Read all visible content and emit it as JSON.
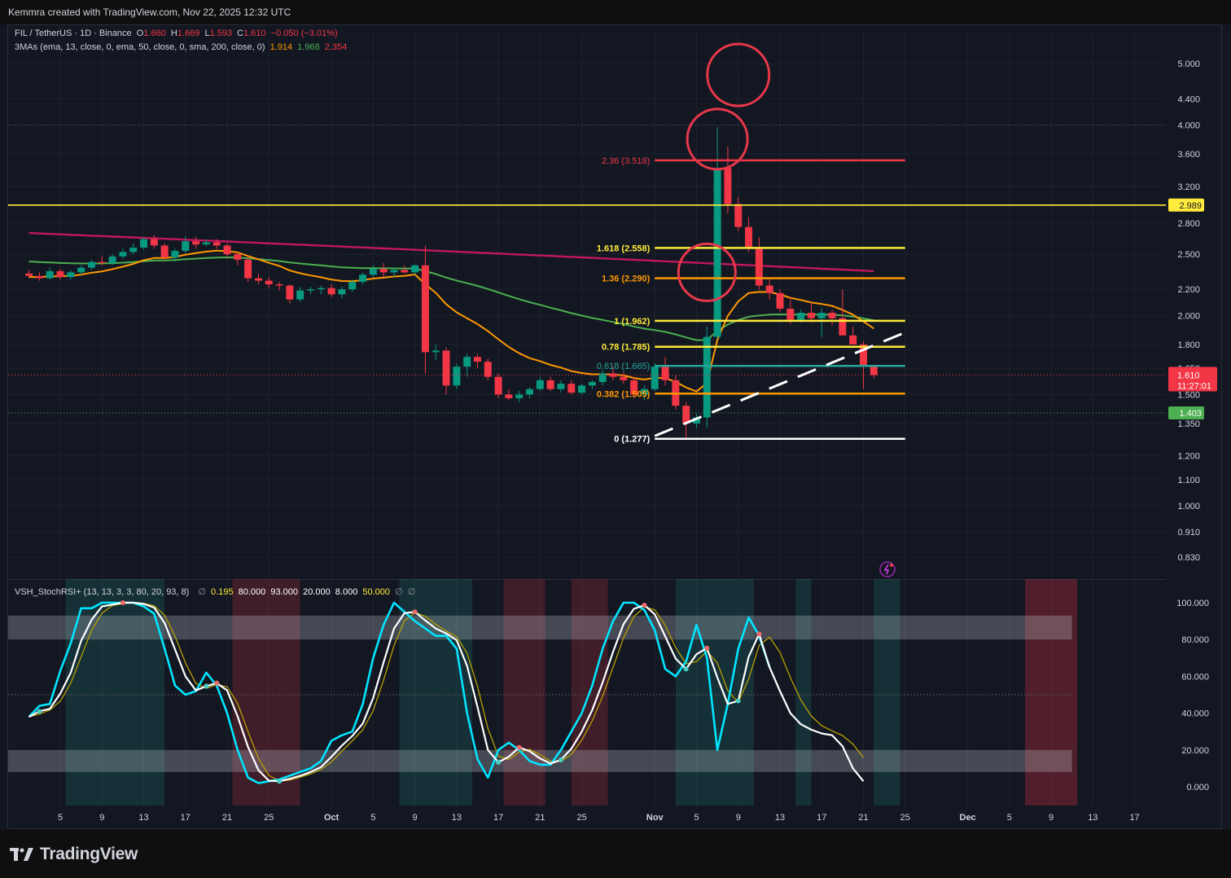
{
  "header": {
    "credit": "Kemmra created with TradingView.com, Nov 22, 2025 12:32 UTC"
  },
  "legend": {
    "symbol": "FIL / TetherUS · 1D · Binance",
    "o_label": "O",
    "o_value": "1.660",
    "h_label": "H",
    "h_value": "1.669",
    "l_label": "L",
    "l_value": "1.593",
    "c_label": "C",
    "c_value": "1.610",
    "change": "−0.050 (−3.01%)",
    "ma_title": "3MAs (ema, 13, close, 0, ema, 50, close, 0, sma, 200, close, 0)",
    "ma1": "1.914",
    "ma2": "1.968",
    "ma3": "2.354"
  },
  "indicator_legend": {
    "title": "VSH_StochRSI+ (13, 13, 3, 3, 80, 20, 93, 8)",
    "v0": "∅",
    "v1": "0.195",
    "v2": "80.000",
    "v3": "93.000",
    "v4": "20.000",
    "v5": "8.000",
    "v6": "50.000",
    "v7": "∅",
    "v8": "∅"
  },
  "price_axis": {
    "labels": [
      "5.000",
      "4.400",
      "4.000",
      "3.600",
      "3.200",
      "2.800",
      "2.500",
      "2.200",
      "2.000",
      "1.800",
      "1.650",
      "1.500",
      "1.350",
      "1.200",
      "1.100",
      "1.000",
      "0.910",
      "0.830"
    ]
  },
  "indicator_axis": {
    "labels": [
      "100.000",
      "80.000",
      "60.000",
      "40.000",
      "20.000",
      "0.000"
    ]
  },
  "time_axis": {
    "labels": [
      "5",
      "9",
      "13",
      "17",
      "21",
      "25",
      "Oct",
      "5",
      "9",
      "13",
      "17",
      "21",
      "25",
      "Nov",
      "5",
      "9",
      "13",
      "17",
      "21",
      "25",
      "Dec",
      "5",
      "9",
      "13",
      "17"
    ]
  },
  "tags": {
    "resistance": "2.989",
    "last_price": "1.610",
    "countdown": "11:27:01",
    "support": "1.403"
  },
  "colors": {
    "background": "#131722",
    "bull": "#089981",
    "bear": "#f23645",
    "ema13": "#ff9800",
    "ema50": "#4caf50",
    "sma200": "#c2185b",
    "fib_yellow": "#ffeb3b",
    "fib_red": "#f23645",
    "fib_orange": "#ff9800",
    "fib_teal": "#26a69a",
    "stoch_k": "#00e5ff",
    "stoch_d": "#ffffff",
    "stoch_signal": "#b8a000",
    "circle": "#e8374a"
  },
  "chart_data": [
    {
      "type": "candlestick",
      "title": "FIL / TetherUS · 1D · Binance",
      "y_scale": "log",
      "ylim": [
        0.78,
        5.6
      ],
      "x_dates": [
        "2025-09-02",
        "2025-12-19"
      ],
      "ohlc": [
        [
          "2025-09-02",
          2.33,
          2.36,
          2.29,
          2.31
        ],
        [
          "2025-09-03",
          2.31,
          2.34,
          2.27,
          2.29
        ],
        [
          "2025-09-04",
          2.29,
          2.38,
          2.28,
          2.35
        ],
        [
          "2025-09-05",
          2.35,
          2.37,
          2.28,
          2.3
        ],
        [
          "2025-09-06",
          2.3,
          2.36,
          2.28,
          2.34
        ],
        [
          "2025-09-07",
          2.34,
          2.4,
          2.32,
          2.38
        ],
        [
          "2025-09-08",
          2.38,
          2.45,
          2.36,
          2.43
        ],
        [
          "2025-09-09",
          2.43,
          2.48,
          2.4,
          2.42
        ],
        [
          "2025-09-10",
          2.42,
          2.5,
          2.4,
          2.48
        ],
        [
          "2025-09-11",
          2.48,
          2.55,
          2.46,
          2.52
        ],
        [
          "2025-09-12",
          2.52,
          2.6,
          2.5,
          2.56
        ],
        [
          "2025-09-13",
          2.56,
          2.66,
          2.54,
          2.64
        ],
        [
          "2025-09-14",
          2.64,
          2.68,
          2.55,
          2.58
        ],
        [
          "2025-09-15",
          2.58,
          2.6,
          2.44,
          2.47
        ],
        [
          "2025-09-16",
          2.47,
          2.55,
          2.43,
          2.53
        ],
        [
          "2025-09-17",
          2.53,
          2.67,
          2.51,
          2.62
        ],
        [
          "2025-09-18",
          2.62,
          2.66,
          2.55,
          2.59
        ],
        [
          "2025-09-19",
          2.59,
          2.64,
          2.57,
          2.61
        ],
        [
          "2025-09-20",
          2.61,
          2.64,
          2.55,
          2.58
        ],
        [
          "2025-09-21",
          2.58,
          2.6,
          2.47,
          2.5
        ],
        [
          "2025-09-22",
          2.5,
          2.52,
          2.4,
          2.45
        ],
        [
          "2025-09-23",
          2.45,
          2.48,
          2.26,
          2.29
        ],
        [
          "2025-09-24",
          2.29,
          2.33,
          2.24,
          2.27
        ],
        [
          "2025-09-25",
          2.27,
          2.3,
          2.21,
          2.24
        ],
        [
          "2025-09-26",
          2.24,
          2.26,
          2.19,
          2.23
        ],
        [
          "2025-09-27",
          2.23,
          2.24,
          2.09,
          2.12
        ],
        [
          "2025-09-28",
          2.12,
          2.22,
          2.1,
          2.19
        ],
        [
          "2025-09-29",
          2.19,
          2.22,
          2.16,
          2.2
        ],
        [
          "2025-09-30",
          2.2,
          2.23,
          2.16,
          2.21
        ],
        [
          "2025-10-01",
          2.21,
          2.24,
          2.14,
          2.16
        ],
        [
          "2025-10-02",
          2.16,
          2.22,
          2.13,
          2.2
        ],
        [
          "2025-10-03",
          2.2,
          2.28,
          2.18,
          2.26
        ],
        [
          "2025-10-04",
          2.26,
          2.34,
          2.24,
          2.32
        ],
        [
          "2025-10-05",
          2.32,
          2.4,
          2.3,
          2.37
        ],
        [
          "2025-10-06",
          2.37,
          2.42,
          2.3,
          2.34
        ],
        [
          "2025-10-07",
          2.34,
          2.38,
          2.3,
          2.36
        ],
        [
          "2025-10-08",
          2.36,
          2.4,
          2.33,
          2.34
        ],
        [
          "2025-10-09",
          2.34,
          2.41,
          2.32,
          2.4
        ],
        [
          "2025-10-10",
          2.4,
          2.58,
          1.62,
          1.75
        ],
        [
          "2025-10-11",
          1.75,
          1.8,
          1.7,
          1.76
        ],
        [
          "2025-10-12",
          1.76,
          1.78,
          1.5,
          1.55
        ],
        [
          "2025-10-13",
          1.55,
          1.68,
          1.53,
          1.66
        ],
        [
          "2025-10-14",
          1.66,
          1.74,
          1.6,
          1.72
        ],
        [
          "2025-10-15",
          1.72,
          1.74,
          1.65,
          1.69
        ],
        [
          "2025-10-16",
          1.69,
          1.71,
          1.58,
          1.6
        ],
        [
          "2025-10-17",
          1.6,
          1.62,
          1.48,
          1.5
        ],
        [
          "2025-10-18",
          1.5,
          1.53,
          1.47,
          1.48
        ],
        [
          "2025-10-19",
          1.48,
          1.52,
          1.46,
          1.5
        ],
        [
          "2025-10-20",
          1.5,
          1.54,
          1.48,
          1.53
        ],
        [
          "2025-10-21",
          1.53,
          1.6,
          1.52,
          1.58
        ],
        [
          "2025-10-22",
          1.58,
          1.6,
          1.52,
          1.53
        ],
        [
          "2025-10-23",
          1.53,
          1.58,
          1.51,
          1.56
        ],
        [
          "2025-10-24",
          1.56,
          1.58,
          1.5,
          1.51
        ],
        [
          "2025-10-25",
          1.51,
          1.56,
          1.5,
          1.55
        ],
        [
          "2025-10-26",
          1.55,
          1.58,
          1.53,
          1.57
        ],
        [
          "2025-10-27",
          1.57,
          1.64,
          1.55,
          1.62
        ],
        [
          "2025-10-28",
          1.62,
          1.66,
          1.58,
          1.6
        ],
        [
          "2025-10-29",
          1.6,
          1.63,
          1.56,
          1.58
        ],
        [
          "2025-10-30",
          1.58,
          1.6,
          1.48,
          1.5
        ],
        [
          "2025-10-31",
          1.5,
          1.55,
          1.47,
          1.53
        ],
        [
          "2025-11-01",
          1.53,
          1.68,
          1.52,
          1.66
        ],
        [
          "2025-11-02",
          1.66,
          1.72,
          1.55,
          1.58
        ],
        [
          "2025-11-03",
          1.58,
          1.61,
          1.42,
          1.44
        ],
        [
          "2025-11-04",
          1.44,
          1.46,
          1.28,
          1.35
        ],
        [
          "2025-11-05",
          1.35,
          1.4,
          1.33,
          1.38
        ],
        [
          "2025-11-06",
          1.38,
          1.92,
          1.33,
          1.85
        ],
        [
          "2025-11-07",
          1.85,
          3.97,
          1.84,
          3.42
        ],
        [
          "2025-11-08",
          3.42,
          3.7,
          2.9,
          3.0
        ],
        [
          "2025-11-09",
          3.0,
          3.08,
          2.72,
          2.76
        ],
        [
          "2025-11-10",
          2.76,
          2.86,
          2.52,
          2.56
        ],
        [
          "2025-11-11",
          2.56,
          2.66,
          2.2,
          2.23
        ],
        [
          "2025-11-12",
          2.23,
          2.28,
          2.12,
          2.17
        ],
        [
          "2025-11-13",
          2.17,
          2.2,
          2.03,
          2.05
        ],
        [
          "2025-11-14",
          2.05,
          2.14,
          1.94,
          1.97
        ],
        [
          "2025-11-15",
          1.97,
          2.04,
          1.95,
          2.02
        ],
        [
          "2025-11-16",
          2.02,
          2.1,
          1.95,
          1.98
        ],
        [
          "2025-11-17",
          1.98,
          2.05,
          1.85,
          2.02
        ],
        [
          "2025-11-18",
          2.02,
          2.04,
          1.93,
          1.98
        ],
        [
          "2025-11-19",
          1.98,
          2.2,
          1.9,
          1.86
        ],
        [
          "2025-11-20",
          1.86,
          1.92,
          1.8,
          1.8
        ],
        [
          "2025-11-21",
          1.8,
          1.82,
          1.53,
          1.66
        ],
        [
          "2025-11-22",
          1.66,
          1.669,
          1.593,
          1.61
        ]
      ],
      "moving_averages": [
        {
          "name": "ema 13",
          "last": 1.914
        },
        {
          "name": "ema 50",
          "last": 1.968
        },
        {
          "name": "sma 200",
          "last": 2.354
        }
      ],
      "fib_levels": [
        {
          "ratio": "0",
          "price": 1.277,
          "label": "0 (1.277)"
        },
        {
          "ratio": "0.382",
          "price": 1.505,
          "label": "0.382 (1.505)"
        },
        {
          "ratio": "0.618",
          "price": 1.665,
          "label": "0.618 (1.665)"
        },
        {
          "ratio": "0.78",
          "price": 1.785,
          "label": "0.78 (1.785)"
        },
        {
          "ratio": "1",
          "price": 1.962,
          "label": "1 (1.962)"
        },
        {
          "ratio": "1.36",
          "price": 2.29,
          "label": "1.36 (2.290)"
        },
        {
          "ratio": "1.618",
          "price": 2.558,
          "label": "1.618 (2.558)"
        },
        {
          "ratio": "2.36",
          "price": 3.518,
          "label": "2.36 (3.518)"
        }
      ],
      "horizontal_lines": [
        {
          "price": 2.989,
          "style": "solid"
        },
        {
          "price": 1.61,
          "style": "dotted"
        },
        {
          "price": 1.403,
          "style": "dotted"
        }
      ],
      "trendline": {
        "from": [
          "2025-11-01",
          1.29
        ],
        "to": [
          "2025-11-25",
          1.88
        ],
        "style": "dashed"
      },
      "annotations": [
        {
          "shape": "circle",
          "date": "2025-11-09",
          "price": 4.8
        },
        {
          "shape": "circle",
          "date": "2025-11-07",
          "price": 3.8
        },
        {
          "shape": "circle",
          "date": "2025-11-06",
          "price": 2.34
        }
      ]
    },
    {
      "type": "line",
      "title": "VSH_StochRSI+ (13, 13, 3, 3, 80, 20, 93, 8)",
      "ylim": [
        0,
        100
      ],
      "bands": [
        [
          80,
          93
        ],
        [
          8,
          20
        ]
      ],
      "x_dates": [
        "2025-09-02",
        "2025-11-21"
      ],
      "k": [
        38,
        44,
        45,
        63,
        78,
        97,
        97,
        100,
        100,
        100,
        100,
        98,
        94,
        75,
        55,
        50,
        52,
        62,
        55,
        40,
        20,
        5,
        2,
        3,
        4,
        6,
        8,
        10,
        14,
        25,
        28,
        30,
        45,
        70,
        88,
        100,
        95,
        90,
        86,
        82,
        82,
        75,
        40,
        15,
        5,
        20,
        24,
        20,
        14,
        12,
        12,
        20,
        30,
        40,
        55,
        75,
        90,
        100,
        100,
        96,
        85,
        64,
        60,
        68,
        88,
        70,
        20,
        45,
        75,
        92,
        82,
        65,
        52,
        40,
        34,
        31,
        29,
        28,
        22,
        10,
        3
      ]
    }
  ]
}
